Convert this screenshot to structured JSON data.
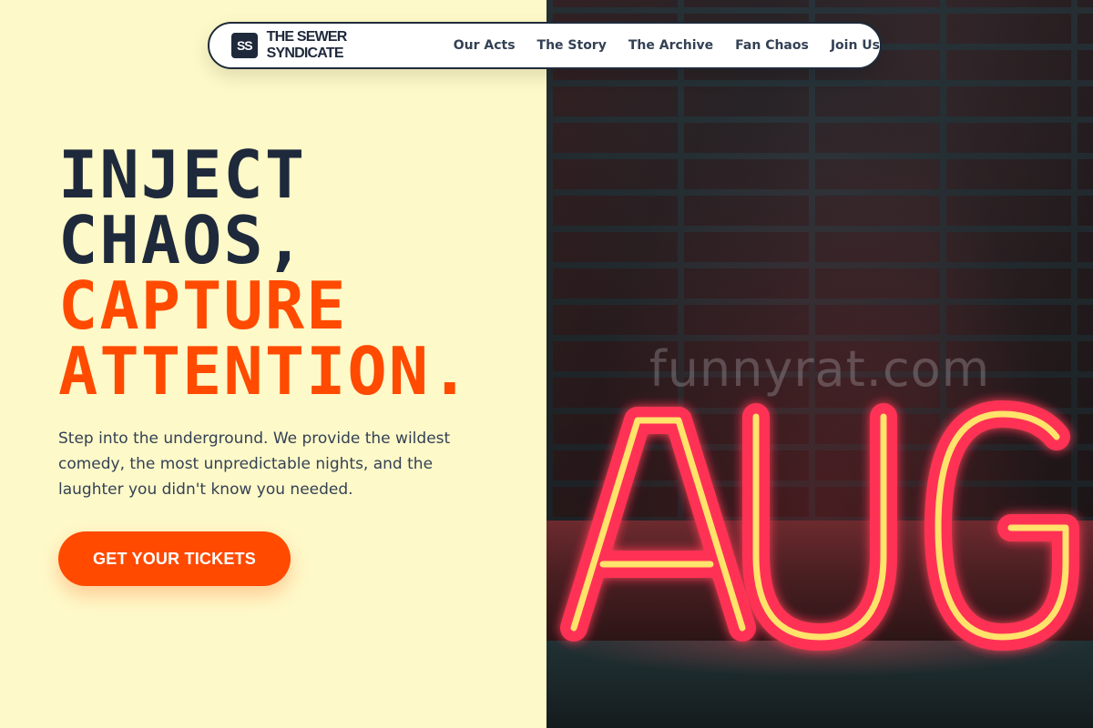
{
  "brand": {
    "mark": "SS",
    "name": "THE SEWER SYNDICATE"
  },
  "nav": {
    "links": [
      {
        "label": "Our Acts"
      },
      {
        "label": "The Story"
      },
      {
        "label": "The Archive"
      },
      {
        "label": "Fan Chaos"
      },
      {
        "label": "Join Us"
      }
    ]
  },
  "hero": {
    "headline_line1": "INJECT",
    "headline_line2": "CHAOS,",
    "headline_line3": "CAPTURE",
    "headline_line4": "ATTENTION.",
    "intro": "Step into the underground. We provide the wildest comedy, the most unpredictable nights, and the laughter you didn't know you needed.",
    "cta_label": "GET YOUR TICKETS"
  },
  "image": {
    "neon_text": "AUG",
    "watermark": "funnyrat.com"
  },
  "colors": {
    "background_left": "#fef9c8",
    "text_dark": "#1e293b",
    "accent": "#ff4a00",
    "neon_pink": "#ff3355",
    "neon_yellow": "#ffe36a"
  }
}
